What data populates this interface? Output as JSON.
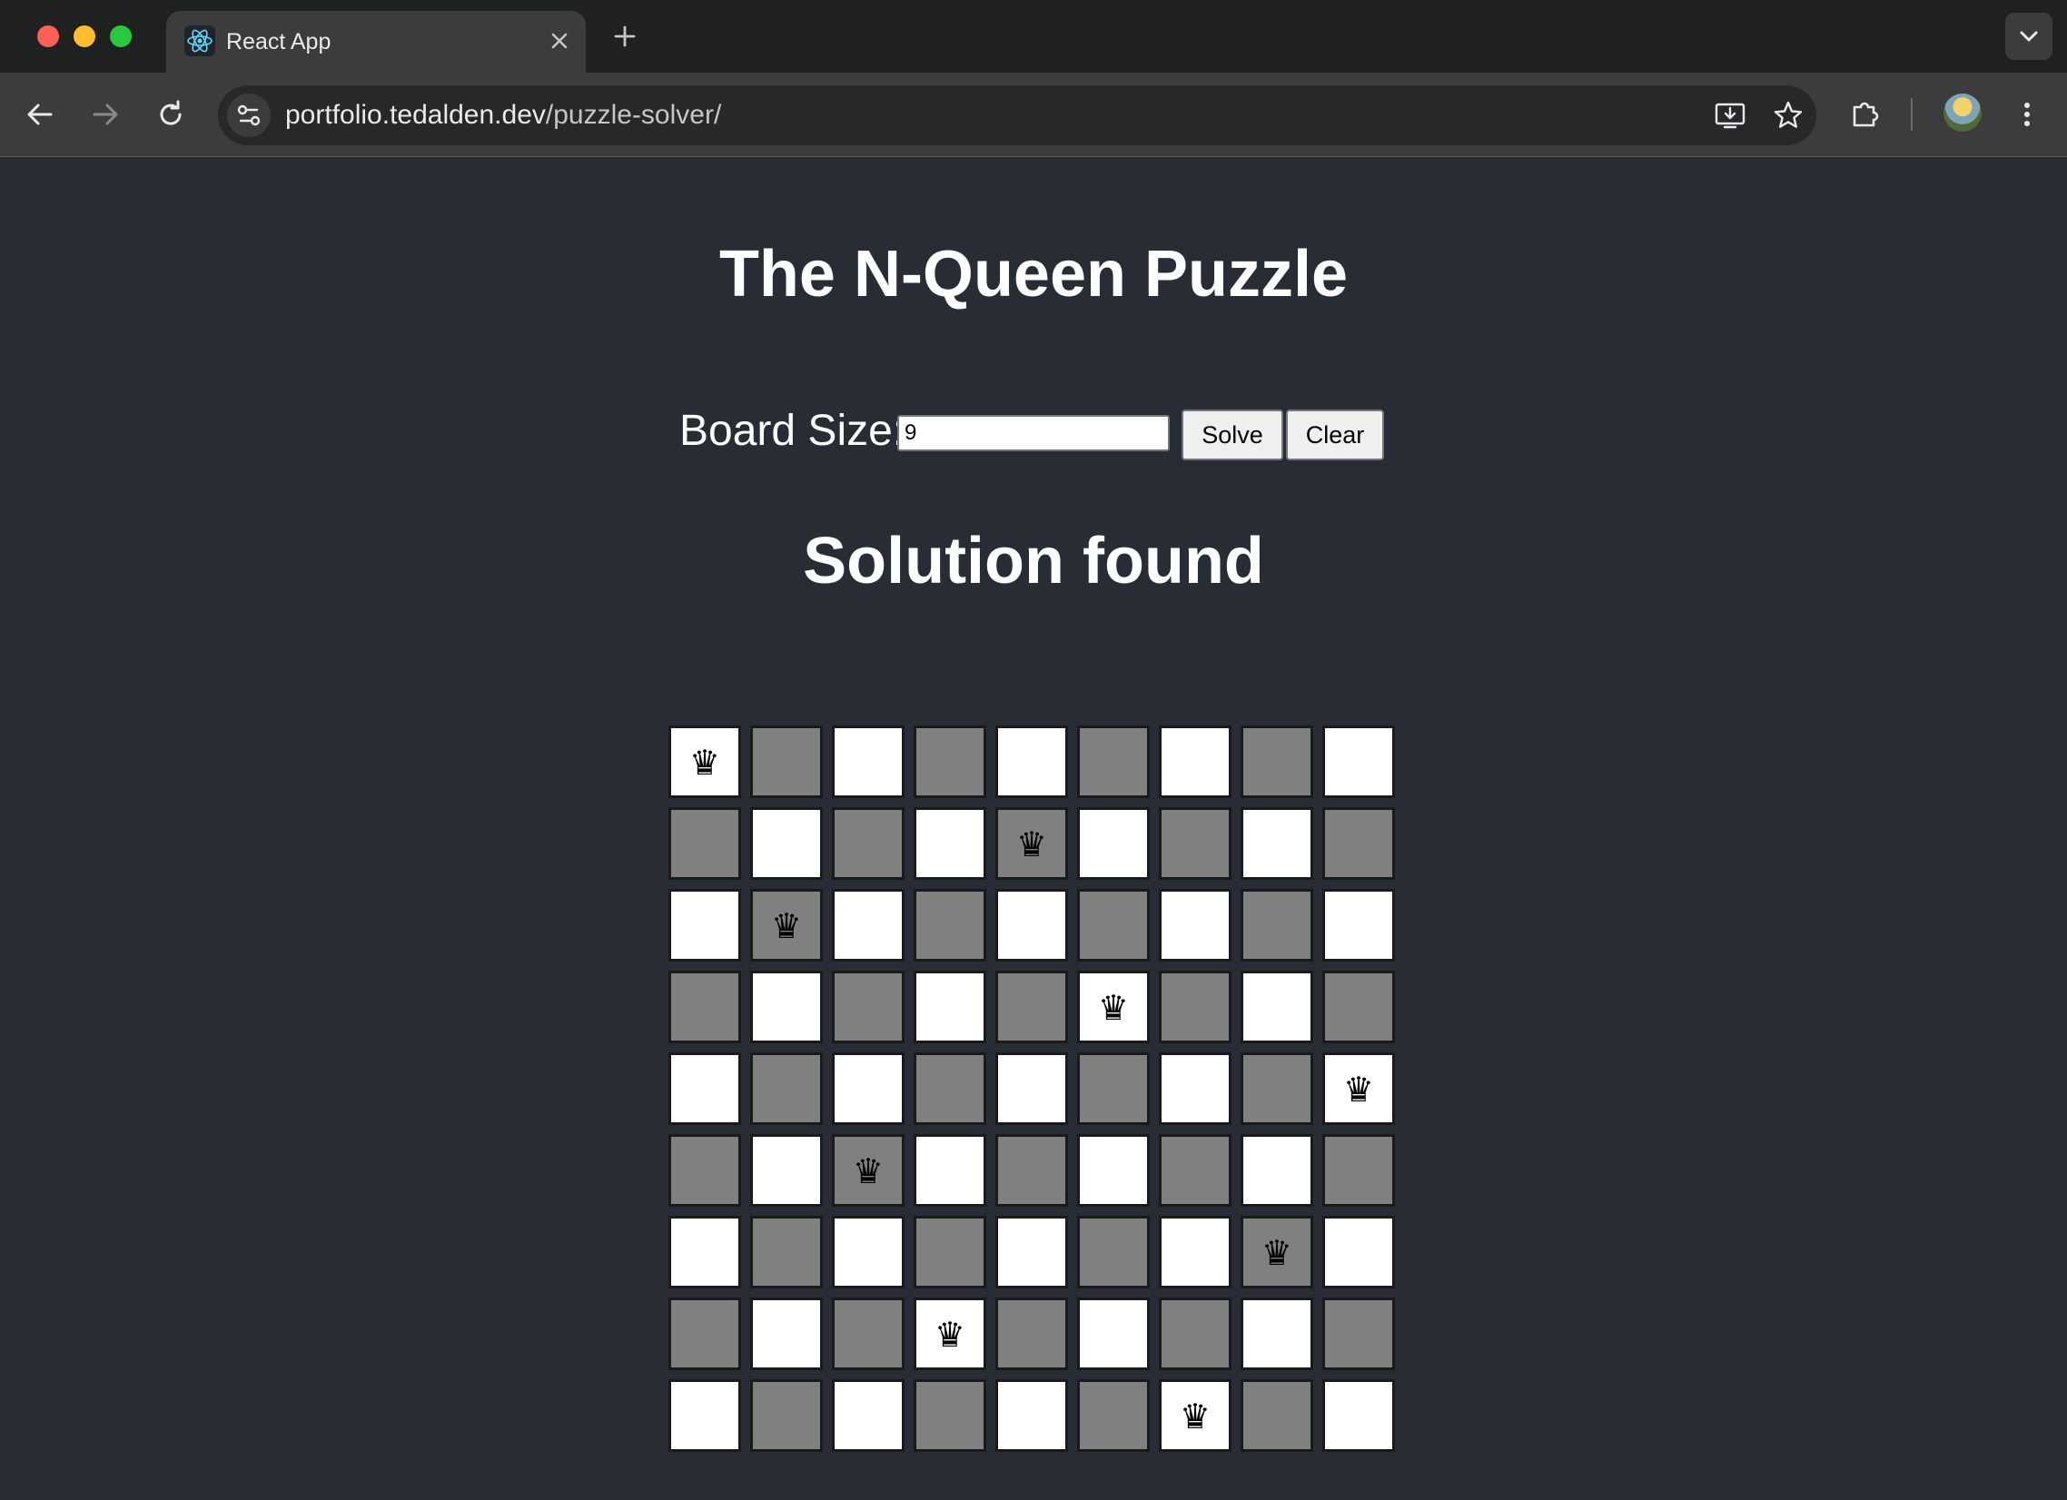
{
  "browser": {
    "tab_title": "React App",
    "url_host": "portfolio.tedalden.dev",
    "url_path": "/puzzle-solver/"
  },
  "page": {
    "title": "The N-Queen Puzzle",
    "board_size_label": "Board Size:",
    "board_size_value": "9",
    "solve_label": "Solve",
    "clear_label": "Clear",
    "status": "Solution found"
  },
  "board": {
    "size": 9,
    "queen_glyph": "♛",
    "queen_columns_by_row": [
      0,
      4,
      1,
      5,
      8,
      2,
      7,
      3,
      6
    ],
    "light_color": "#ffffff",
    "dark_color": "#808080"
  },
  "colors": {
    "page_background": "#282c34",
    "chrome_dark": "#1f2020",
    "chrome_toolbar": "#3c3c3c"
  },
  "icons": [
    "react-logo-icon",
    "close-icon",
    "new-tab-icon",
    "chevron-down-icon",
    "back-arrow-icon",
    "forward-arrow-icon",
    "reload-icon",
    "site-settings-icon",
    "install-app-icon",
    "bookmark-star-icon",
    "extensions-icon",
    "more-vertical-icon"
  ]
}
